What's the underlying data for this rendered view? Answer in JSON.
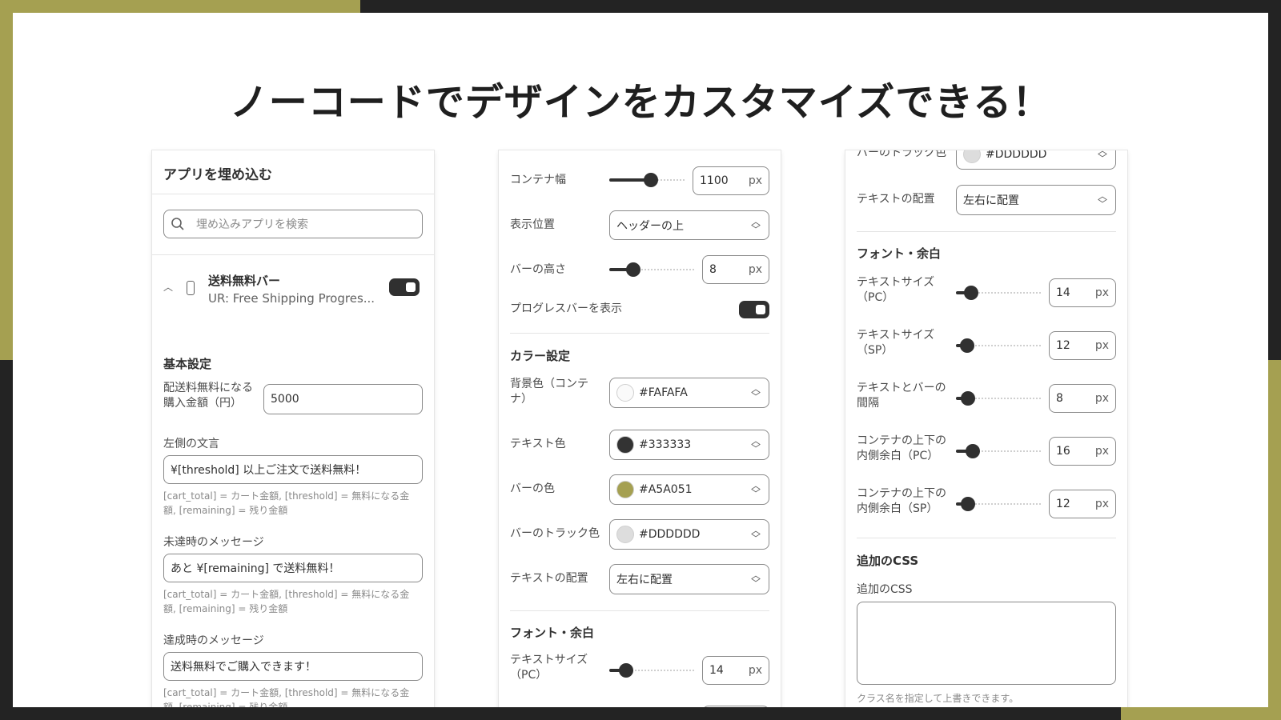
{
  "headline": "ノーコードでデザインをカスタマイズできる！",
  "panel1": {
    "title": "アプリを埋め込む",
    "search_placeholder": "埋め込みアプリを検索",
    "app_name": "送料無料バー",
    "app_sub": "UR: Free Shipping Progres...",
    "section_basic": "基本設定",
    "threshold_label": "配送料無料になる購入金額（円）",
    "threshold_value": "5000",
    "left_text_label": "左側の文言",
    "left_text_value": "¥[threshold] 以上ご注文で送料無料！",
    "hint": "[cart_total] = カート金額, [threshold] = 無料になる金額, [remaining] = 残り金額",
    "unreached_label": "未達時のメッセージ",
    "unreached_value": "あと ¥[remaining] で送料無料！",
    "achieved_label": "達成時のメッセージ",
    "achieved_value": "送料無料でご購入できます！"
  },
  "panel2": {
    "container_width_label": "コンテナ幅",
    "container_width_value": "1100",
    "container_width_level": 0.55,
    "position_label": "表示位置",
    "position_value": "ヘッダーの上",
    "bar_height_label": "バーの高さ",
    "bar_height_value": "8",
    "bar_height_level": 0.28,
    "show_progress_label": "プログレスバーを表示",
    "color_heading": "カラー設定",
    "bg_color_label": "背景色（コンテナ）",
    "bg_color_value": "#FAFAFA",
    "text_color_label": "テキスト色",
    "text_color_value": "#333333",
    "bar_color_label": "バーの色",
    "bar_color_value": "#A5A051",
    "track_color_label": "バーのトラック色",
    "track_color_value": "#DDDDDD",
    "align_label": "テキストの配置",
    "align_value": "左右に配置",
    "font_heading": "フォント・余白",
    "text_size_pc_label": "テキストサイズ（PC）",
    "text_size_pc_value": "14",
    "text_size_pc_level": 0.2
  },
  "panel3": {
    "track_color_label": "バーのトラック色",
    "track_color_value": "#DDDDDD",
    "align_label": "テキストの配置",
    "align_value": "左右に配置",
    "font_heading": "フォント・余白",
    "text_size_pc_label": "テキストサイズ（PC）",
    "text_size_pc_value": "14",
    "text_size_pc_level": 0.18,
    "text_size_sp_label": "テキストサイズ（SP）",
    "text_size_sp_value": "12",
    "text_size_sp_level": 0.13,
    "gap_label": "テキストとバーの間隔",
    "gap_value": "8",
    "gap_level": 0.14,
    "pad_pc_label": "コンテナの上下の内側余白（PC）",
    "pad_pc_value": "16",
    "pad_pc_level": 0.2,
    "pad_sp_label": "コンテナの上下の内側余白（SP）",
    "pad_sp_value": "12",
    "pad_sp_level": 0.14,
    "css_heading": "追加のCSS",
    "css_label": "追加のCSS",
    "css_value": "",
    "css_hint": "クラス名を指定して上書きできます。"
  },
  "unit_px": "px",
  "colors": {
    "accent": "#A5A051",
    "dark": "#232323",
    "swatch_fafafa": "#FAFAFA",
    "swatch_333333": "#333333",
    "swatch_a5a051": "#A5A051",
    "swatch_dddddd": "#DDDDDD"
  }
}
